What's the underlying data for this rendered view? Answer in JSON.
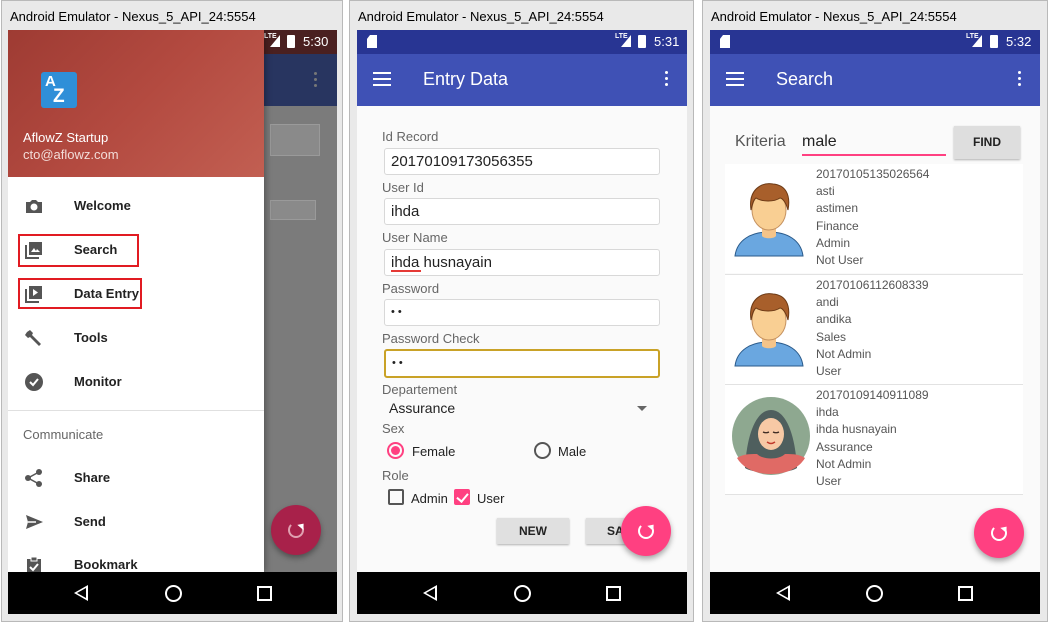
{
  "windows": [
    {
      "title": "Android Emulator - Nexus_5_API_24:5554"
    },
    {
      "title": "Android Emulator - Nexus_5_API_24:5554"
    },
    {
      "title": "Android Emulator - Nexus_5_API_24:5554"
    }
  ],
  "status_times": [
    "5:30",
    "5:31",
    "5:32"
  ],
  "lte": "LTE",
  "drawer": {
    "app_name": "AflowZ Startup",
    "email": "cto@aflowz.com",
    "logo_a": "A",
    "logo_z": "Z",
    "items": [
      {
        "label": "Welcome",
        "icon": "camera-icon"
      },
      {
        "label": "Search",
        "icon": "image-icon"
      },
      {
        "label": "Data Entry",
        "icon": "video-library-icon"
      },
      {
        "label": "Tools",
        "icon": "wrench-icon"
      },
      {
        "label": "Monitor",
        "icon": "check-circle-icon"
      }
    ],
    "section": "Communicate",
    "comm_items": [
      {
        "label": "Share",
        "icon": "share-icon"
      },
      {
        "label": "Send",
        "icon": "send-icon"
      },
      {
        "label": "Bookmark",
        "icon": "clipboard-icon"
      }
    ]
  },
  "entry": {
    "title": "Entry Data",
    "fields": [
      {
        "label": "Id Record",
        "value": "20170109173056355"
      },
      {
        "label": "User Id",
        "value": "ihda"
      },
      {
        "label": "User Name",
        "value": "ihda husnayain"
      },
      {
        "label": "Password",
        "value": "• •"
      },
      {
        "label": "Password Check",
        "value": "• •"
      }
    ],
    "department_label": "Departement",
    "department_value": "Assurance",
    "sex_label": "Sex",
    "sex_options": [
      "Female",
      "Male"
    ],
    "sex_selected": "Female",
    "role_label": "Role",
    "role_options": [
      {
        "label": "Admin",
        "checked": false
      },
      {
        "label": "User",
        "checked": true
      }
    ],
    "new_button": "NEW",
    "save_button": "SA"
  },
  "search": {
    "title": "Search",
    "kriteria_label": "Kriteria",
    "kriteria_value": "male",
    "find_button": "FIND",
    "results": [
      {
        "id": "20170105135026564",
        "user_id": "asti",
        "name": "astimen",
        "dept": "Finance",
        "admin": "Admin",
        "role": "Not User",
        "avatar": "male-avatar-icon"
      },
      {
        "id": "20170106112608339",
        "user_id": "andi",
        "name": "andika",
        "dept": "Sales",
        "admin": "Not Admin",
        "role": "User",
        "avatar": "male-avatar-icon"
      },
      {
        "id": "20170109140911089",
        "user_id": "ihda",
        "name": "ihda husnayain",
        "dept": "Assurance",
        "admin": "Not Admin",
        "role": "User",
        "avatar": "hijab-avatar-icon"
      }
    ]
  },
  "colors": {
    "primary": "#3f51b5",
    "primary_dark": "#283593",
    "accent": "#ff4081",
    "highlight": "#e11b22",
    "drawer_header": "#b34a40"
  }
}
